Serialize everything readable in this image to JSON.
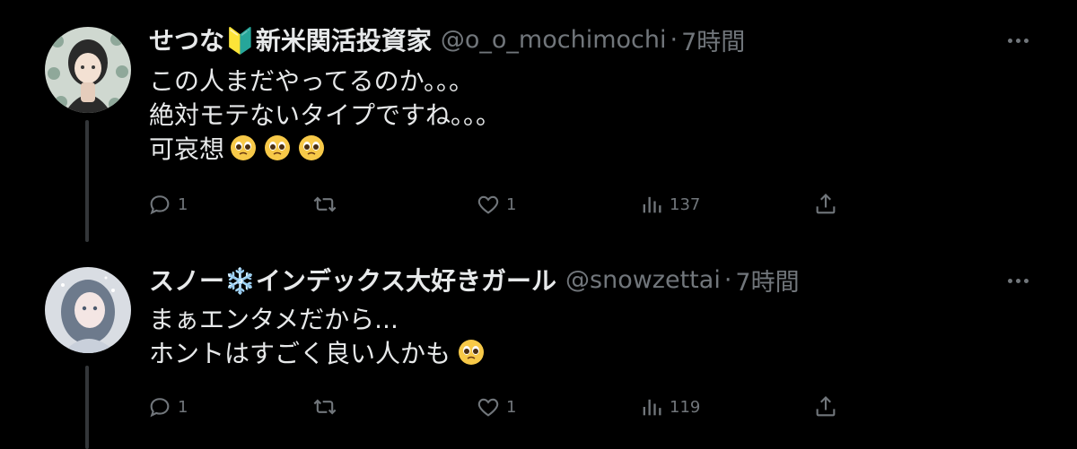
{
  "tweets": [
    {
      "name": "せつな🔰新米関活投資家",
      "handle": "@o_o_mochimochi",
      "dot": "·",
      "time": "7時間",
      "lines": [
        "この人まだやってるのか。。。",
        "絶対モテないタイプですね。。。",
        "可哀想"
      ],
      "emoji_count": 3,
      "replies": "1",
      "retweets": "",
      "likes": "1",
      "views": "137"
    },
    {
      "name": "スノー❄️インデックス大好きガール",
      "handle": "@snowzettai",
      "dot": "·",
      "time": "7時間",
      "lines": [
        "まぁエンタメだから...",
        "ホントはすごく良い人かも"
      ],
      "emoji_count": 1,
      "replies": "1",
      "retweets": "",
      "likes": "1",
      "views": "119"
    }
  ],
  "icons": {
    "reply": "reply-icon",
    "retweet": "retweet-icon",
    "like": "heart-icon",
    "views": "views-icon",
    "share": "share-icon",
    "more": "more-icon",
    "emoji": "pleading-face-emoji"
  },
  "colors": {
    "background": "#000000",
    "text": "#e7e9ea",
    "muted": "#71767b",
    "line": "#333639"
  }
}
